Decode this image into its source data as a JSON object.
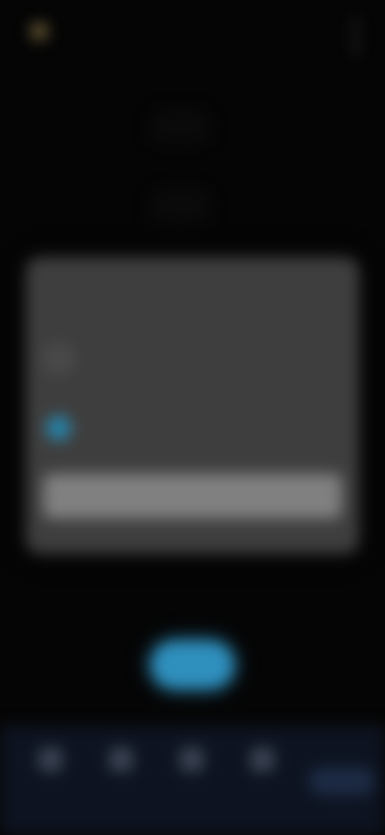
{
  "header": {
    "title": "",
    "subtitle": ""
  },
  "rows": [
    {
      "left": "",
      "right": ""
    },
    {
      "left": "",
      "right": ""
    }
  ],
  "card": {
    "title": "",
    "options": [
      {
        "label": "",
        "selected": false
      },
      {
        "label": "",
        "selected": true
      }
    ],
    "button_label": ""
  },
  "hint": "",
  "primary_button": {
    "label": ""
  },
  "bottom_nav": {
    "items": [
      {
        "label": ""
      },
      {
        "label": ""
      },
      {
        "label": ""
      },
      {
        "label": ""
      }
    ]
  },
  "colors": {
    "accent": "#2f8fbd",
    "card": "#3e3e3e",
    "nav": "#0d1320"
  },
  "icons": [
    "logo-icon",
    "more-vertical-icon",
    "home-icon",
    "search-icon",
    "list-icon",
    "person-icon"
  ]
}
